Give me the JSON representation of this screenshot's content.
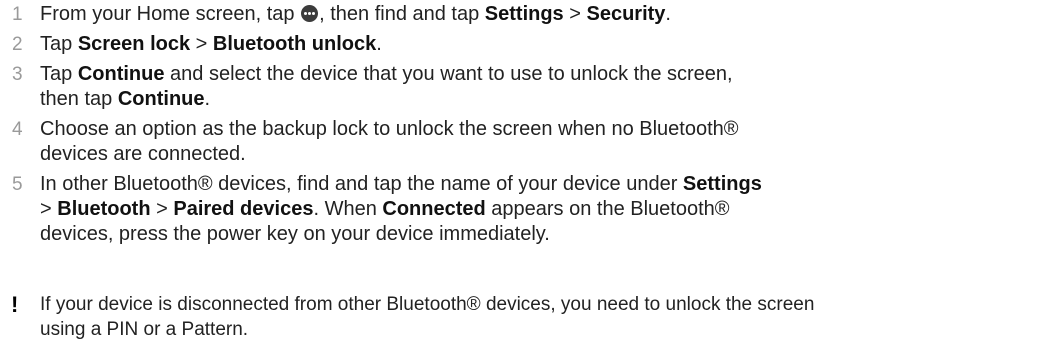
{
  "steps": [
    {
      "number": "1",
      "parts": [
        "From your Home screen, tap ",
        ", then find and tap ",
        "Settings",
        " > ",
        "Security",
        "."
      ],
      "icon": "apps-icon"
    },
    {
      "number": "2",
      "parts": [
        "Tap ",
        "Screen lock",
        " > ",
        "Bluetooth unlock",
        "."
      ]
    },
    {
      "number": "3",
      "parts": [
        "Tap ",
        "Continue",
        " and select the device that you want to use to unlock the screen,",
        "then tap ",
        "Continue",
        "."
      ]
    },
    {
      "number": "4",
      "parts": [
        "Choose an option as the backup lock to unlock the screen when no Bluetooth®",
        "devices are connected."
      ]
    },
    {
      "number": "5",
      "parts": [
        "In other Bluetooth® devices, find and tap the name of your device under ",
        "Settings",
        "> ",
        "Bluetooth",
        " > ",
        "Paired devices",
        ". When ",
        "Connected",
        " appears on the Bluetooth®",
        "devices, press the power key on your device immediately."
      ]
    }
  ],
  "note": {
    "icon": "exclamation-icon",
    "symbol": "!",
    "line1": "If your device is disconnected from other Bluetooth® devices, you need to unlock the screen",
    "line2": "using a PIN or a Pattern."
  }
}
